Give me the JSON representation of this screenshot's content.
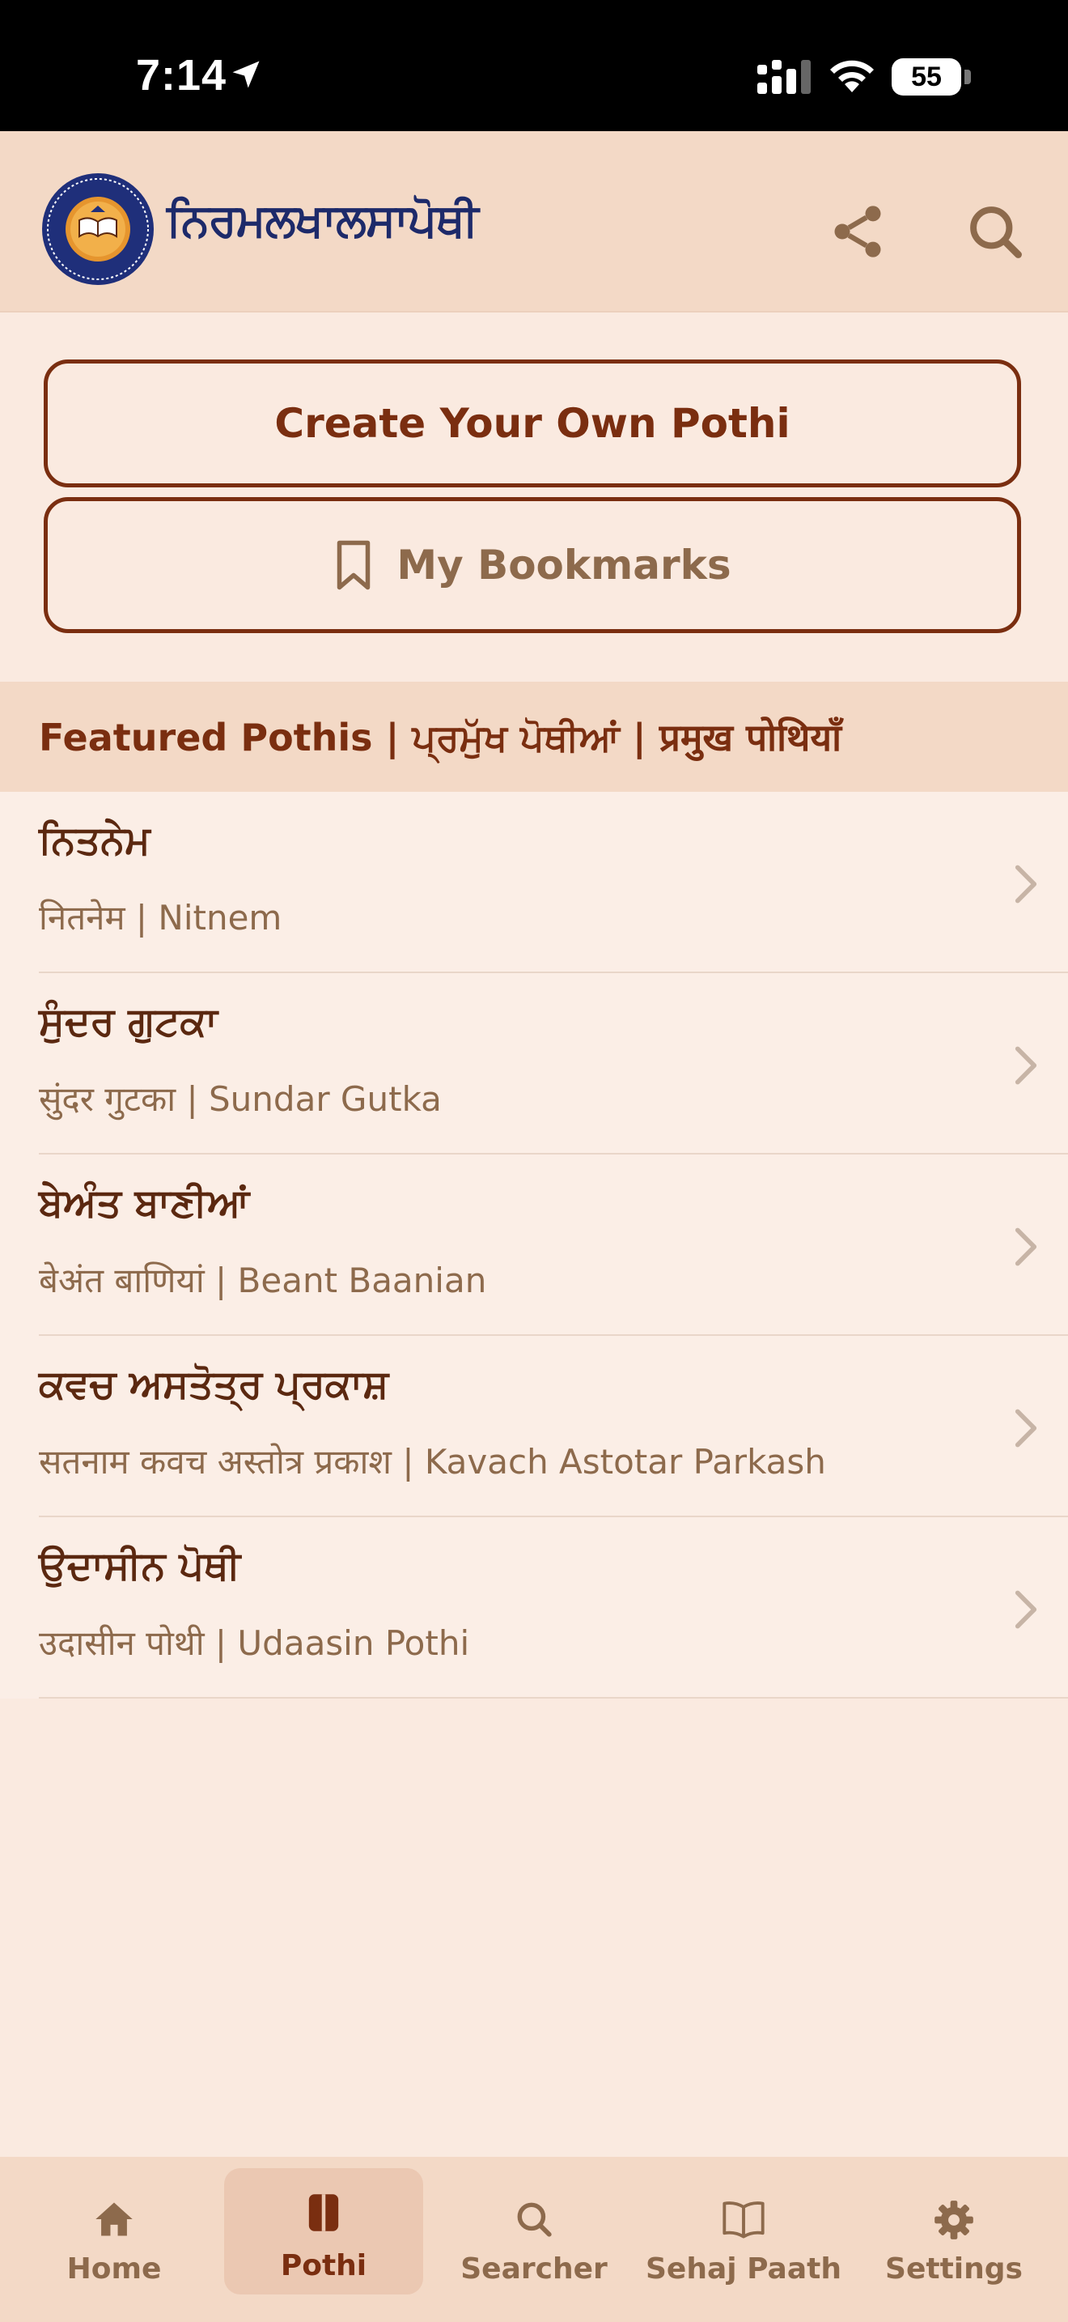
{
  "status_bar": {
    "time": "7:14",
    "battery": "55"
  },
  "header": {
    "logo_text": "ਨਿਰਮਲਖਾਲਸਾਪੋਥੀ",
    "seal_text": "NIRMAL KHALSA POTHI"
  },
  "actions": {
    "create_label": "Create Your Own Pothi",
    "bookmarks_label": "My Bookmarks"
  },
  "featured": {
    "heading": "Featured Pothis | ਪ੍ਰਮੁੱਖ ਪੋਥੀਆਂ | प्रमुख पोथियाँ",
    "items": [
      {
        "title": "ਨਿਤਨੇਮ",
        "subtitle": "नितनेम | Nitnem"
      },
      {
        "title": "ਸੁੰਦਰ ਗੁਟਕਾ",
        "subtitle": "सुंदर गुटका | Sundar Gutka"
      },
      {
        "title": "ਬੇਅੰਤ ਬਾਣੀਆਂ",
        "subtitle": "बेअंत बाणियां | Beant Baanian"
      },
      {
        "title": "ਕਵਚ ਅਸਤੋਤ੍ਰ ਪ੍ਰਕਾਸ਼",
        "subtitle": "सतनाम कवच अस्तोत्र प्रकाश | Kavach Astotar Parkash"
      },
      {
        "title": "ਉਦਾਸੀਨ ਪੋਥੀ",
        "subtitle": "उदासीन पोथी | Udaasin Pothi"
      }
    ]
  },
  "tabs": [
    {
      "label": "Home",
      "icon": "home-icon"
    },
    {
      "label": "Pothi",
      "icon": "book-icon",
      "active": true
    },
    {
      "label": "Searcher",
      "icon": "search-icon"
    },
    {
      "label": "Sehaj Paath",
      "icon": "open-book-icon"
    },
    {
      "label": "Settings",
      "icon": "gear-icon"
    }
  ],
  "colors": {
    "accent": "#7a2e10",
    "muted": "#8d6a4c",
    "header_bg": "#f3d9c6",
    "page_bg": "#faeae0",
    "logo_text": "#1d2a6a"
  }
}
